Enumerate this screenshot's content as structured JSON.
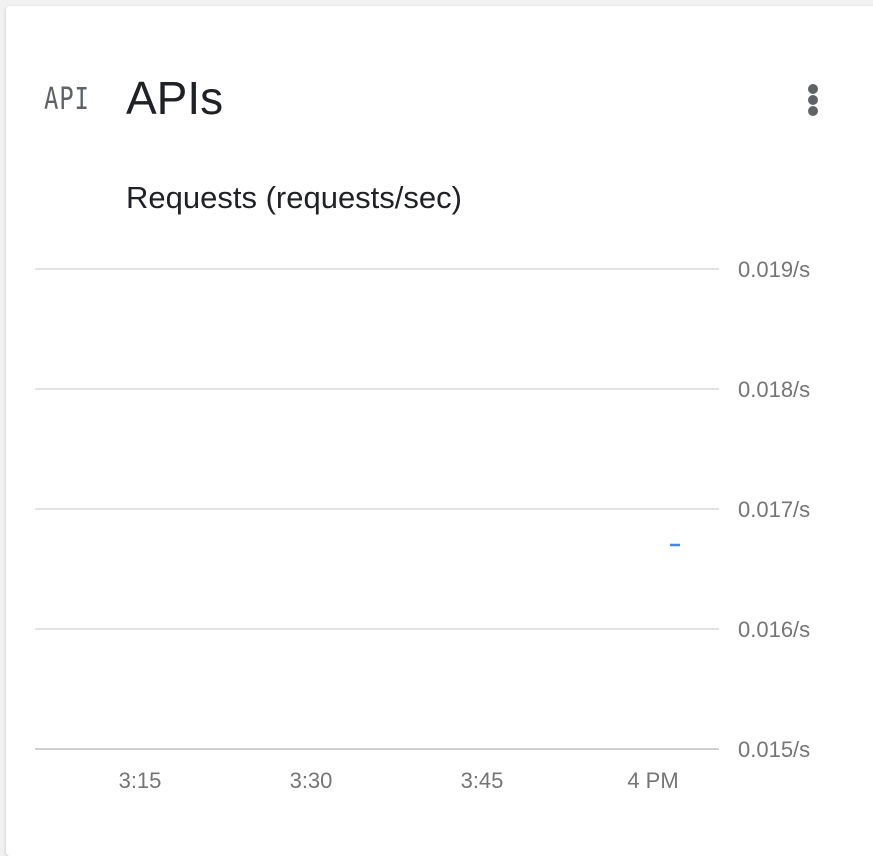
{
  "card": {
    "icon_text": "API",
    "title": "APIs",
    "more_icon": "more-vert-icon"
  },
  "chart_data": {
    "type": "line",
    "title": "Requests (requests/sec)",
    "ylim": [
      0.015,
      0.019
    ],
    "y_ticks": [
      "0.019/s",
      "0.018/s",
      "0.017/s",
      "0.016/s",
      "0.015/s"
    ],
    "y_tick_values": [
      0.019,
      0.018,
      0.017,
      0.016,
      0.015
    ],
    "x_ticks": [
      "3:15",
      "3:30",
      "3:45",
      "4 PM"
    ],
    "series": [
      {
        "x": [
          "4:02"
        ],
        "values": [
          0.0167
        ],
        "color": "#4285f4"
      }
    ],
    "grid": true,
    "y_axis_position": "right"
  }
}
